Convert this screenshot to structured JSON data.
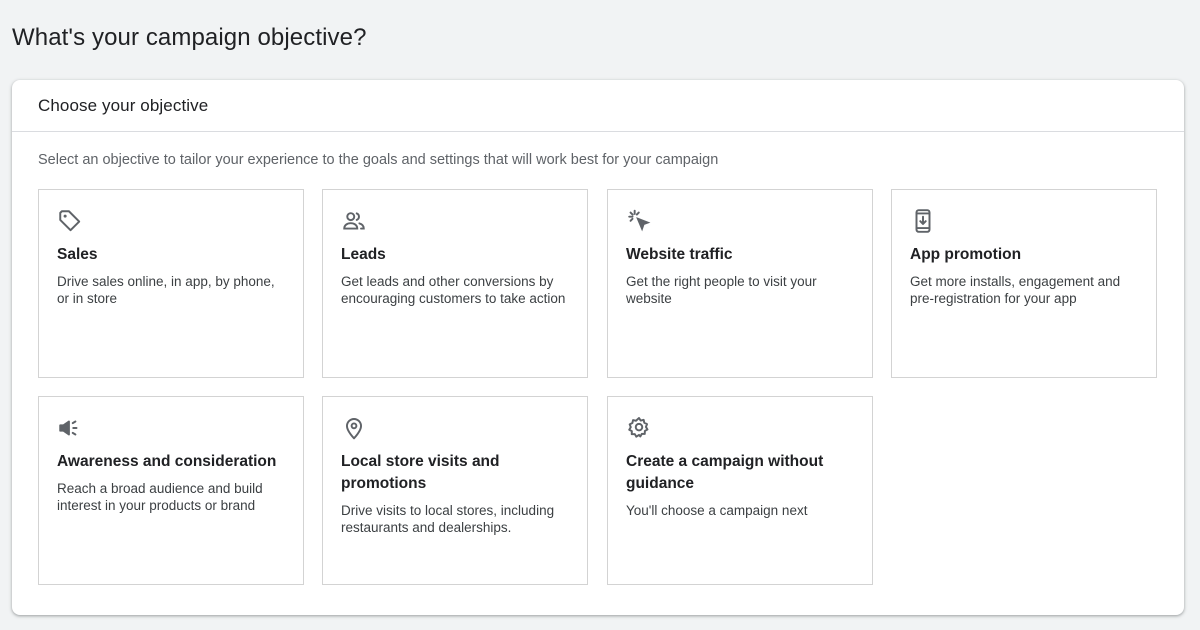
{
  "page": {
    "title": "What's your campaign objective?"
  },
  "objective_card": {
    "title": "Choose your objective",
    "description": "Select an objective to tailor your experience to the goals and settings that will work best for your campaign",
    "tiles": [
      {
        "icon": "tag-icon",
        "title": "Sales",
        "description": "Drive sales online, in app, by phone, or in store"
      },
      {
        "icon": "people-icon",
        "title": "Leads",
        "description": "Get leads and other conversions by encouraging customers to take action"
      },
      {
        "icon": "cursor-click-icon",
        "title": "Website traffic",
        "description": "Get the right people to visit your website"
      },
      {
        "icon": "phone-download-icon",
        "title": "App promotion",
        "description": "Get more installs, engagement and pre-registration for your app"
      },
      {
        "icon": "megaphone-icon",
        "title": "Awareness and consideration",
        "description": "Reach a broad audience and build interest in your products or brand"
      },
      {
        "icon": "location-pin-icon",
        "title": "Local store visits and promotions",
        "description": "Drive visits to local stores, including restaurants and dealerships."
      },
      {
        "icon": "gear-icon",
        "title": "Create a campaign without guidance",
        "description": "You'll choose a campaign next"
      }
    ]
  },
  "colors": {
    "background": "#f1f3f4",
    "card": "#ffffff",
    "tile_border": "#d3d3d3",
    "text_primary": "#202124",
    "text_secondary": "#5f6368",
    "icon": "#5f6368"
  }
}
